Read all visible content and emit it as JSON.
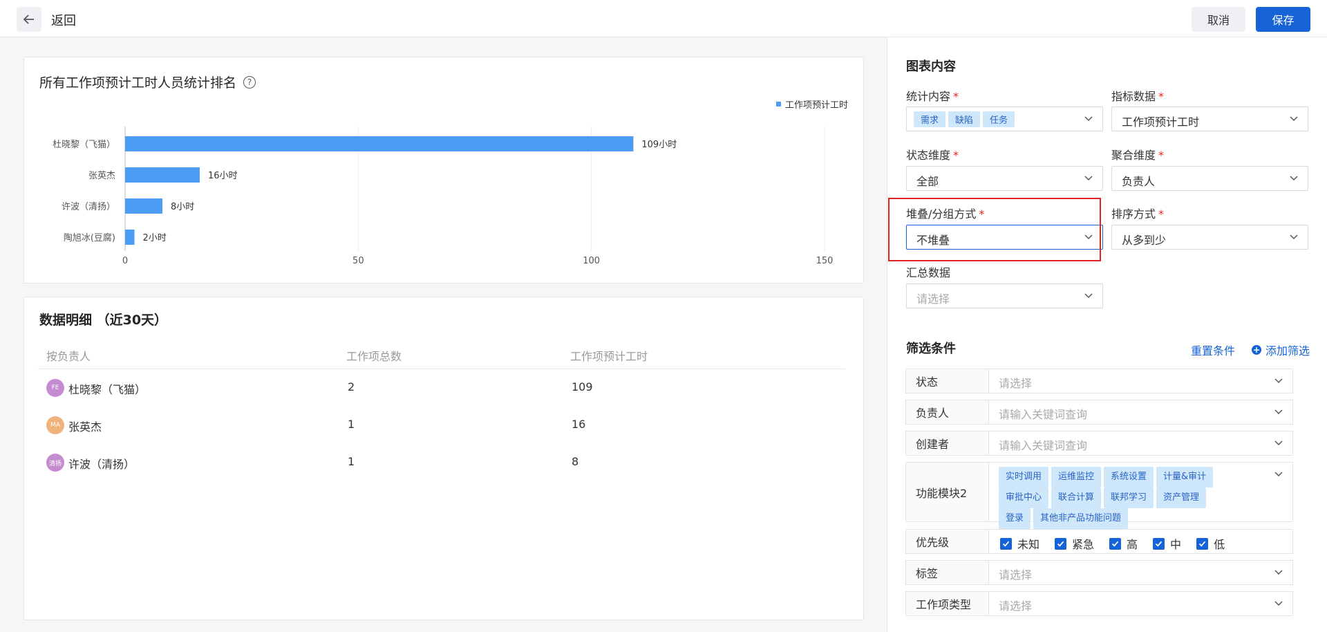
{
  "header": {
    "back_label": "返回",
    "cancel_label": "取消",
    "save_label": "保存"
  },
  "chart_card": {
    "title": "所有工作项预计工时人员统计排名",
    "help": "?"
  },
  "chart_data": {
    "type": "bar",
    "orientation": "horizontal",
    "title": "所有工作项预计工时人员统计排名",
    "categories": [
      "杜晓黎（飞猫）",
      "张英杰",
      "许波（清扬）",
      "陶旭冰(豆腐)"
    ],
    "series": [
      {
        "name": "工作项预计工时",
        "values": [
          109,
          16,
          8,
          2
        ]
      }
    ],
    "data_labels": [
      "109小时",
      "16小时",
      "8小时",
      "2小时"
    ],
    "xlim": [
      0,
      150
    ],
    "xticks": [
      "0",
      "50",
      "100",
      "150"
    ],
    "grid": true,
    "legend": "top-right",
    "color": "#4a9df2"
  },
  "detail": {
    "title": "数据明细 （近30天）",
    "columns": [
      "按负责人",
      "工作项总数",
      "工作项预计工时"
    ],
    "rows": [
      {
        "avatar": "FE",
        "avatar_color": "#c48bd1",
        "name": "杜晓黎（飞猫）",
        "count": "2",
        "hours": "109"
      },
      {
        "avatar": "MA",
        "avatar_color": "#f0b27a",
        "name": "张英杰",
        "count": "1",
        "hours": "16"
      },
      {
        "avatar": "清扬",
        "avatar_color": "#c48bd1",
        "name": "许波（清扬）",
        "count": "1",
        "hours": "8"
      }
    ]
  },
  "panel": {
    "chart_section": "图表内容",
    "stat_content": {
      "label": "统计内容",
      "required": "*",
      "tags": [
        "需求",
        "缺陷",
        "任务"
      ]
    },
    "metric": {
      "label": "指标数据",
      "required": "*",
      "value": "工作项预计工时"
    },
    "status_dim": {
      "label": "状态维度",
      "required": "*",
      "value": "全部"
    },
    "agg_dim": {
      "label": "聚合维度",
      "required": "*",
      "value": "负责人"
    },
    "stack": {
      "label": "堆叠/分组方式",
      "required": "*",
      "value": "不堆叠"
    },
    "sort": {
      "label": "排序方式",
      "required": "*",
      "value": "从多到少"
    },
    "summary": {
      "label": "汇总数据",
      "placeholder": "请选择"
    },
    "filter_section": "筛选条件",
    "reset_label": "重置条件",
    "add_filter_label": "添加筛选",
    "filters": {
      "status": {
        "name": "状态",
        "placeholder": "请选择"
      },
      "owner": {
        "name": "负责人",
        "placeholder": "请输入关键词查询"
      },
      "creator": {
        "name": "创建者",
        "placeholder": "请输入关键词查询"
      },
      "module": {
        "name": "功能模块2",
        "tags": [
          "实时调用",
          "运维监控",
          "系统设置",
          "计量&审计",
          "审批中心",
          "联合计算",
          "联邦学习",
          "资产管理",
          "登录",
          "其他非产品功能问题"
        ]
      },
      "priority": {
        "name": "优先级",
        "options": [
          "未知",
          "紧急",
          "高",
          "中",
          "低"
        ]
      },
      "tags": {
        "name": "标签",
        "placeholder": "请选择"
      },
      "type": {
        "name": "工作项类型",
        "placeholder": "请选择"
      }
    }
  }
}
